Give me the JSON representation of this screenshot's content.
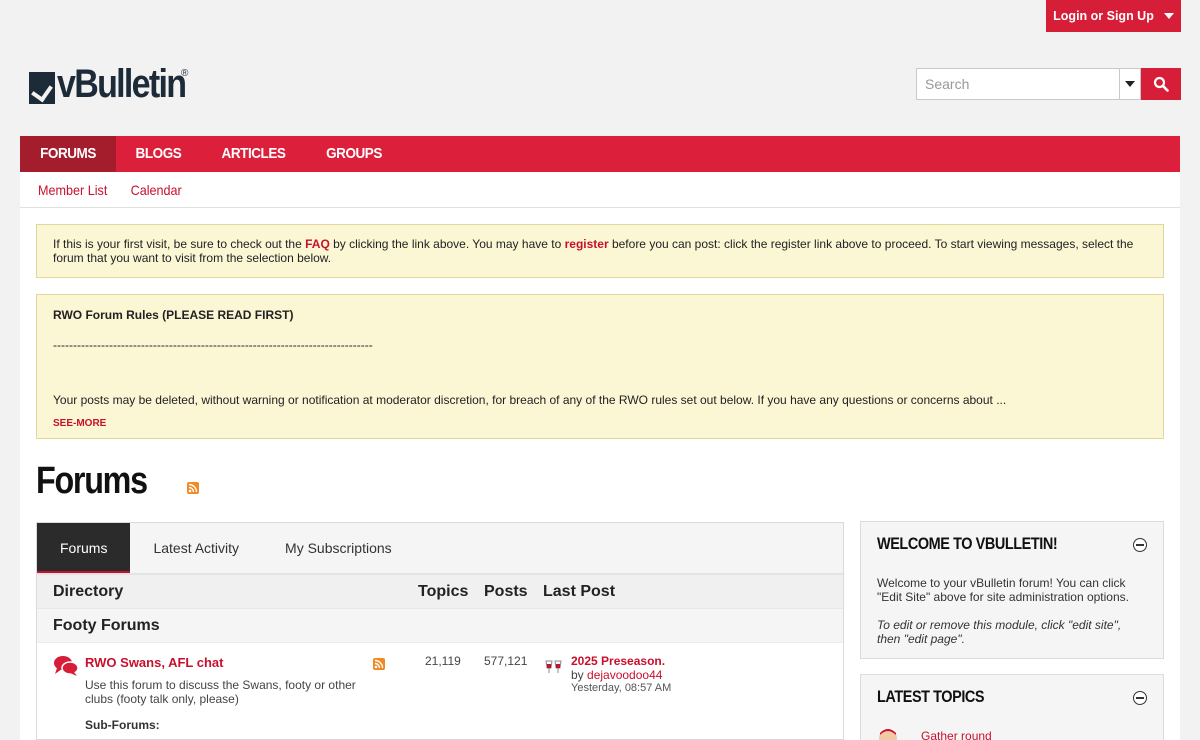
{
  "header": {
    "login_label": "Login or Sign Up",
    "logo_text": "vBulletin",
    "logo_reg": "®",
    "search_placeholder": "Search"
  },
  "nav": {
    "items": [
      "FORUMS",
      "BLOGS",
      "ARTICLES",
      "GROUPS"
    ],
    "active": "FORUMS",
    "sub_items": [
      "Member List",
      "Calendar"
    ]
  },
  "notice": {
    "part1": "If this is your first visit, be sure to check out the ",
    "faq": "FAQ",
    "part2": " by clicking the link above. You may have to ",
    "register": "register",
    "part3": " before you can post: click the register link above to proceed. To start viewing messages, select the forum that you want to visit from the selection below."
  },
  "rules": {
    "title": "RWO Forum Rules (PLEASE READ FIRST)",
    "dashes": "--------------------------------------------------------------------------------",
    "body": "Your posts may be deleted, without warning or notification at moderator discretion, for breach of any of the RWO rules set out below. If you have any questions or concerns about ...",
    "see_more": "SEE-MORE"
  },
  "page": {
    "title": "Forums"
  },
  "tabs": [
    "Forums",
    "Latest Activity",
    "My Subscriptions"
  ],
  "table": {
    "col_directory": "Directory",
    "col_topics": "Topics",
    "col_posts": "Posts",
    "col_last_post": "Last Post",
    "category": "Footy Forums",
    "forum": {
      "name": "RWO Swans, AFL chat",
      "description": "Use this forum to discuss the Swans, footy or other clubs (footy talk only, please)",
      "topics": "21,119",
      "posts": "577,121",
      "last_post_title": "2025 Preseason.",
      "last_post_by_prefix": "by ",
      "last_post_user": "dejavoodoo44",
      "last_post_time": "Yesterday, 08:57 AM",
      "sub_forums_label": "Sub-Forums:"
    }
  },
  "sidebar": {
    "welcome_title": "WELCOME TO VBULLETIN!",
    "welcome_text": "Welcome to your vBulletin forum! You can click \"Edit Site\" above for site administration options.",
    "welcome_italic": "To edit or remove this module, click \"edit site\", then \"edit page\".",
    "latest_title": "LATEST TOPICS",
    "latest_first": "Gather round"
  },
  "colors": {
    "brand_red": "#dc1f3b",
    "nav_active": "#a41d2c",
    "link_red": "#c8102e",
    "notice_bg": "#fbf6d4"
  }
}
